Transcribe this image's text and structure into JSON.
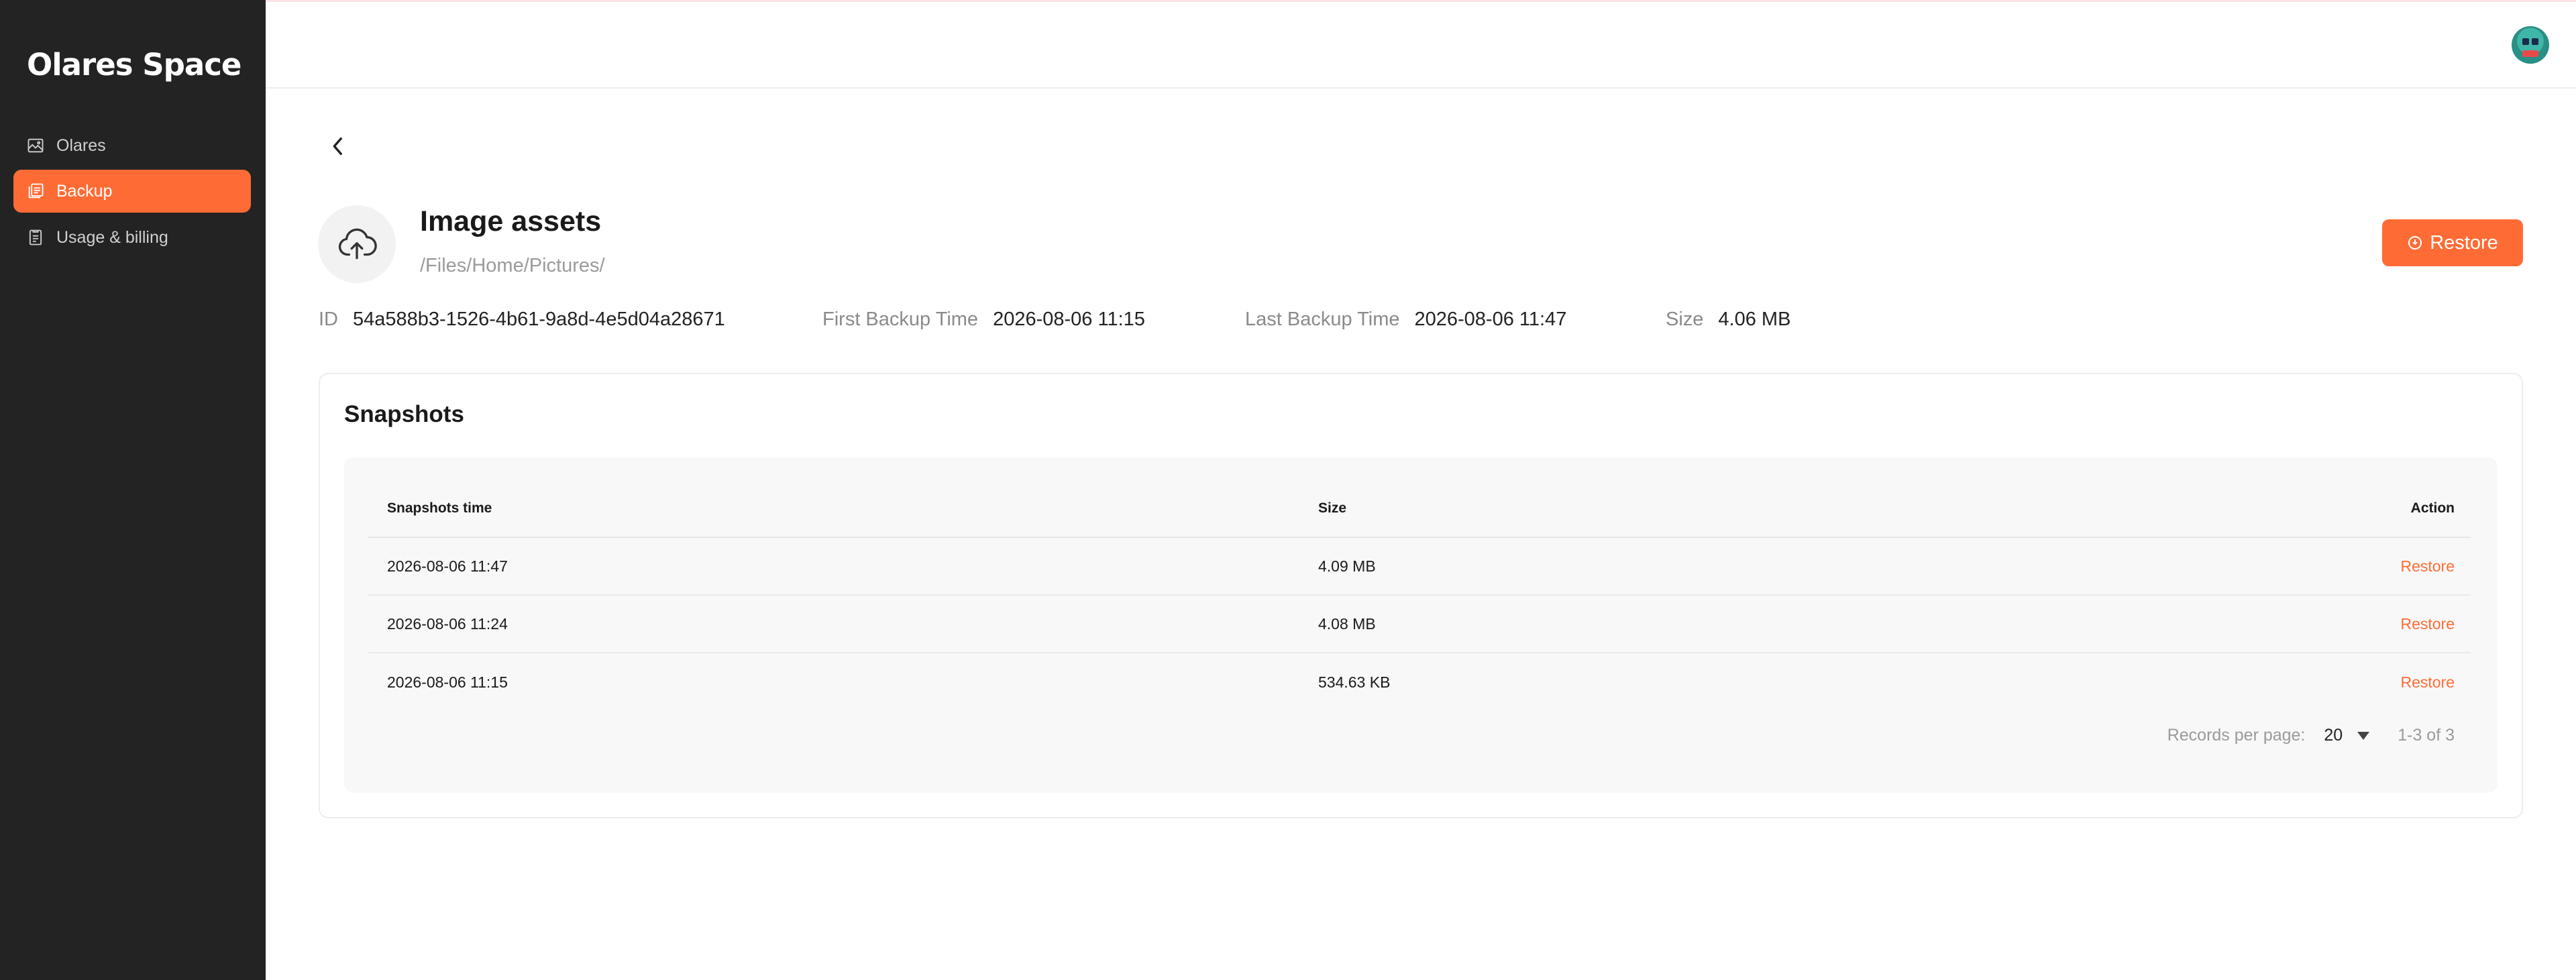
{
  "app": {
    "logo": "Olares Space"
  },
  "sidebar": {
    "items": [
      {
        "label": "Olares",
        "icon": "image-icon",
        "active": false
      },
      {
        "label": "Backup",
        "icon": "backup-icon",
        "active": true
      },
      {
        "label": "Usage & billing",
        "icon": "billing-icon",
        "active": false
      }
    ]
  },
  "backup": {
    "title": "Image assets",
    "path": "/Files/Home/Pictures/",
    "restore_label": "Restore",
    "meta": {
      "id_label": "ID",
      "id_value": "54a588b3-1526-4b61-9a8d-4e5d04a28671",
      "first_label": "First Backup Time",
      "first_value": "2026-08-06 11:15",
      "last_label": "Last Backup Time",
      "last_value": "2026-08-06 11:47",
      "size_label": "Size",
      "size_value": "4.06 MB"
    }
  },
  "snapshots": {
    "title": "Snapshots",
    "columns": [
      "Snapshots time",
      "Size",
      "Action"
    ],
    "rows": [
      {
        "time": "2026-08-06 11:47",
        "size": "4.09 MB",
        "action": "Restore"
      },
      {
        "time": "2026-08-06 11:24",
        "size": "4.08 MB",
        "action": "Restore"
      },
      {
        "time": "2026-08-06 11:15",
        "size": "534.63 KB",
        "action": "Restore"
      }
    ],
    "pagination": {
      "records_label": "Records per page:",
      "per_page": "20",
      "range": "1-3 of 3"
    }
  },
  "colors": {
    "accent": "#ff6b35",
    "sidebar_bg": "#232323"
  }
}
